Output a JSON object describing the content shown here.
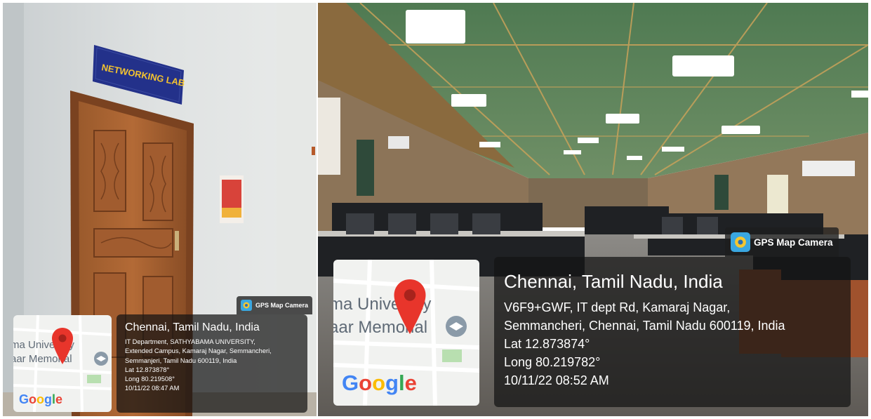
{
  "left_photo": {
    "door_sign": "NETWORKING LAB",
    "badge_label": "GPS Map Camera",
    "map": {
      "label_line1": "ma University",
      "label_line2": "aar Memorial",
      "brand": "Google"
    },
    "location_title": "Chennai, Tamil Nadu, India",
    "address_lines": [
      "IT Department, SATHYABAMA UNIVERSITY,",
      "Extended Campus, Kamaraj Nagar, Semmancheri,",
      "Semmanjeri, Tamil Nadu 600119, India"
    ],
    "lat": "Lat 12.873878°",
    "long": "Long 80.219508°",
    "datetime": "10/11/22 08:47 AM"
  },
  "right_photo": {
    "badge_label": "GPS Map Camera",
    "map": {
      "label_line1": "ma University",
      "label_line2": "aar Memorial",
      "brand": "Google"
    },
    "location_title": "Chennai, Tamil Nadu, India",
    "address_lines": [
      "V6F9+GWF, IT dept Rd, Kamaraj Nagar,",
      "Semmancheri, Chennai, Tamil Nadu 600119, India"
    ],
    "lat": "Lat 12.873874°",
    "long": "Long 80.219782°",
    "datetime": "10/11/22 08:52 AM"
  },
  "colors": {
    "google_blue": "#4285F4",
    "google_red": "#EA4335",
    "google_yellow": "#FBBC05",
    "google_green": "#34A853",
    "pin_red": "#E8352B",
    "sign_blue": "#23318a",
    "sign_text": "#f2c230"
  }
}
